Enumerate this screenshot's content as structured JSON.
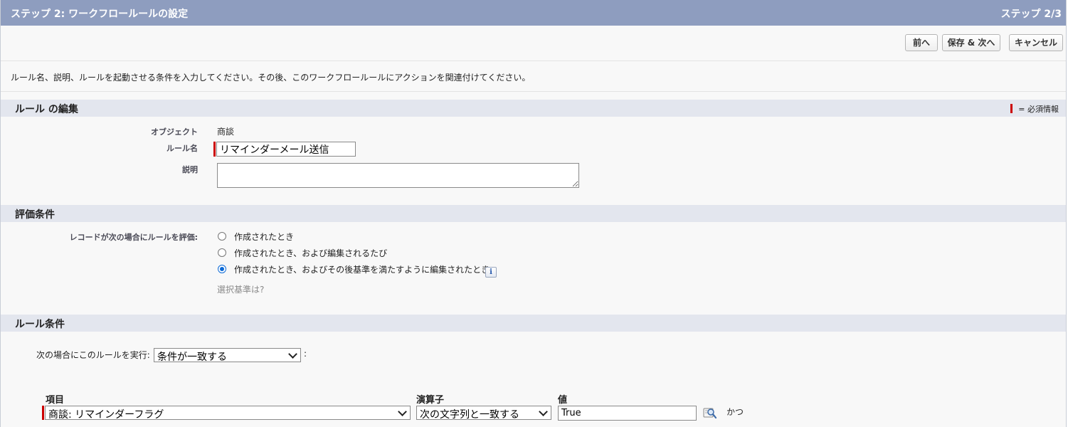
{
  "header": {
    "title": "ステップ 2: ワークフロールールの設定",
    "step": "ステップ 2/3"
  },
  "toolbar": {
    "prev_label": "前へ",
    "save_next_label": "保存 & 次へ",
    "cancel_label": "キャンセル"
  },
  "instructions": "ルール名、説明、ルールを起動させる条件を入力してください。その後、このワークフロールールにアクションを関連付けてください。",
  "rule_edit": {
    "title": "ルール の編集",
    "required_legend": "= 必須情報",
    "object_label": "オブジェクト",
    "object_value": "商談",
    "rule_name_label": "ルール名",
    "rule_name_value": "リマインダーメール送信",
    "description_label": "説明",
    "description_value": ""
  },
  "evaluation": {
    "title": "評価条件",
    "label": "レコードが次の場合にルールを評価:",
    "options": [
      {
        "label": "作成されたとき",
        "checked": false
      },
      {
        "label": "作成されたとき、および編集されるたび",
        "checked": false
      },
      {
        "label": "作成されたとき、およびその後基準を満たすように編集されたとき",
        "checked": true
      }
    ],
    "help_link": "選択基準は?"
  },
  "rule_criteria": {
    "title": "ルール条件",
    "run_label": "次の場合にこのルールを実行:",
    "run_value": "条件が一致する",
    "run_suffix": ":",
    "columns": {
      "field": "項目",
      "operator": "演算子",
      "value": "値"
    },
    "rows": [
      {
        "field": "商談: リマインダーフラグ",
        "operator": "次の文字列と一致する",
        "value": "True",
        "conjunction": "かつ"
      }
    ]
  },
  "icons": {
    "info": "info-icon",
    "lookup": "lookup-icon",
    "dropdown": "chevron-down-icon"
  },
  "colors": {
    "header_bg": "#8e9dbf",
    "section_bg": "#e3e6ee",
    "required": "#cc0000",
    "radio_checked": "#0b69d6"
  }
}
